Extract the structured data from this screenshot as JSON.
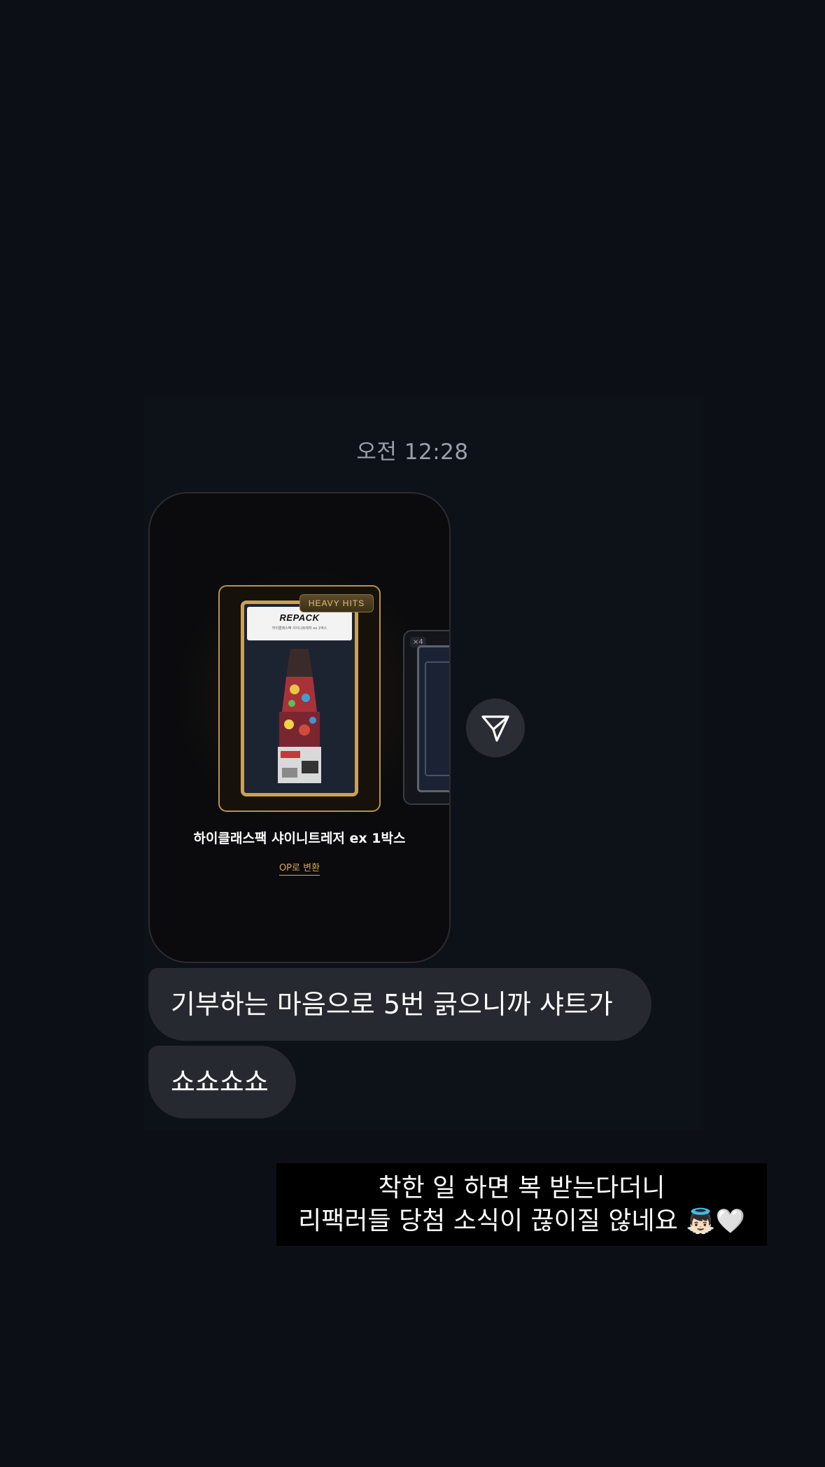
{
  "timestamp": "오전 12:28",
  "product_card": {
    "badge": "HEAVY HITS",
    "box_title": "REPACK",
    "box_subtitle": "하이클래스팩 샤이니트레저 ex 1박스",
    "side_badge": "×4",
    "name": "하이클래스팩 샤이니트레저 ex 1박스",
    "convert_label": "OP로 변환"
  },
  "messages": [
    {
      "text": "기부하는 마음으로 5번 긁으니까 샤트가"
    },
    {
      "text": "쇼쇼쇼쇼"
    }
  ],
  "caption": {
    "line1": "착한 일 하면 복 받는다더니",
    "line2": "리팩러들 당첨 소식이 끊이질 않네요",
    "emojis": "👼🏻🤍"
  },
  "colors": {
    "background": "#0c1016",
    "bubble": "#26292f",
    "gold": "#c9a254"
  },
  "icons": {
    "share": "paper-plane-icon"
  }
}
